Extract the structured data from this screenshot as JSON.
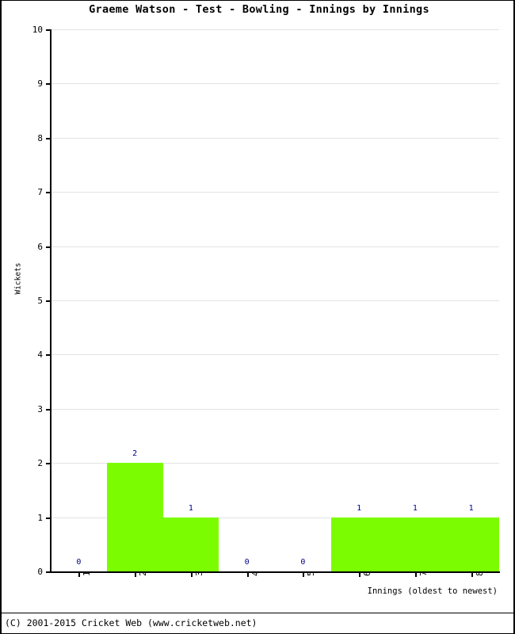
{
  "chart_data": {
    "type": "bar",
    "title": "Graeme Watson - Test - Bowling - Innings by Innings",
    "xlabel": "Innings (oldest to newest)",
    "ylabel": "Wickets",
    "categories": [
      "1",
      "2",
      "3",
      "4",
      "5",
      "6",
      "7",
      "8"
    ],
    "values": [
      0,
      2,
      1,
      0,
      0,
      1,
      1,
      1
    ],
    "data_labels": [
      "0",
      "2",
      "1",
      "0",
      "0",
      "1",
      "1",
      "1"
    ],
    "ylim": [
      0,
      10
    ],
    "ytick_labels": [
      "0",
      "1",
      "2",
      "3",
      "4",
      "5",
      "6",
      "7",
      "8",
      "9",
      "10"
    ],
    "ytick_values": [
      0,
      1,
      2,
      3,
      4,
      5,
      6,
      7,
      8,
      9,
      10
    ],
    "grid": true,
    "legend": null,
    "bar_color": "#7CFC00",
    "label_color": "#00008B",
    "grid_color": "#E3E3E3",
    "axis_color": "#000000"
  },
  "footer": {
    "copyright": "(C) 2001-2015 Cricket Web (www.cricketweb.net)"
  }
}
